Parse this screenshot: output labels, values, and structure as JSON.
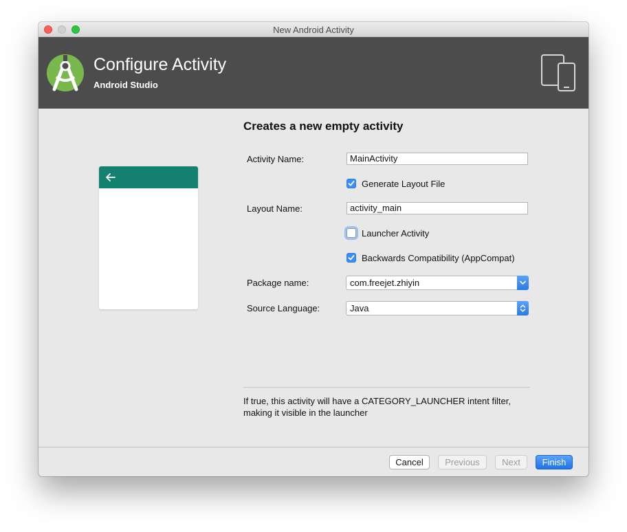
{
  "window": {
    "title": "New Android Activity"
  },
  "header": {
    "title": "Configure Activity",
    "subtitle": "Android Studio",
    "logo_icon": "android-studio-logo-icon",
    "device_icon": "phone-tablet-icon",
    "accent_color": "#4c4c4c"
  },
  "preview": {
    "toolbar_color": "#14806f",
    "back_icon": "arrow-left-icon"
  },
  "form": {
    "title": "Creates a new empty activity",
    "activity_name_label": "Activity Name:",
    "activity_name_value": "MainActivity",
    "generate_layout_label": "Generate Layout File",
    "generate_layout_checked": true,
    "layout_name_label": "Layout Name:",
    "layout_name_value": "activity_main",
    "launcher_label": "Launcher Activity",
    "launcher_checked": false,
    "backwards_label": "Backwards Compatibility (AppCompat)",
    "backwards_checked": true,
    "package_label": "Package name:",
    "package_value": "com.freejet.zhiyin",
    "language_label": "Source Language:",
    "language_value": "Java"
  },
  "help": {
    "line1": "If true, this activity will have a CATEGORY_LAUNCHER intent filter,",
    "line2": "making it visible in the launcher"
  },
  "buttons": {
    "cancel": "Cancel",
    "previous": "Previous",
    "next": "Next",
    "finish": "Finish",
    "primary_color": "#2a7be6"
  }
}
